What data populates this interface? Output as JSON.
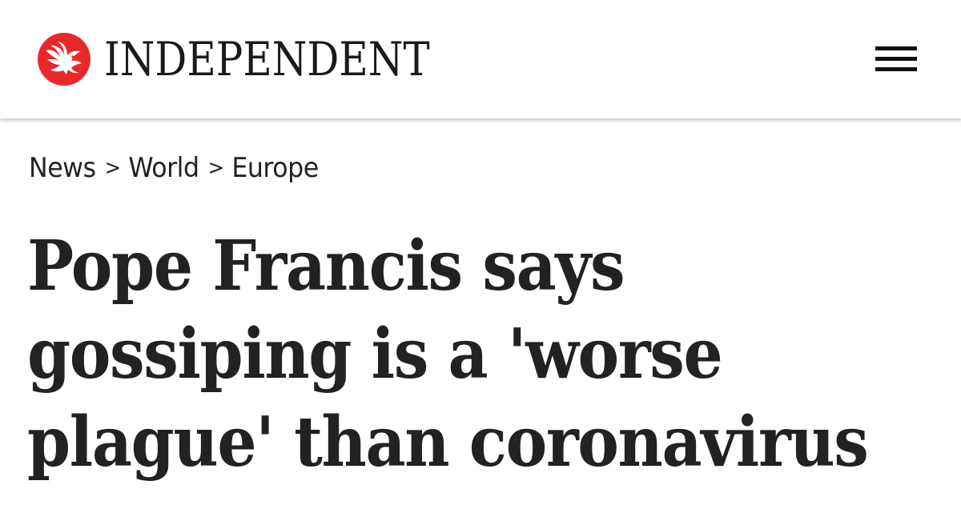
{
  "header": {
    "brand_name": "INDEPENDENT",
    "logo_icon": "eagle-icon",
    "menu_icon": "hamburger-menu-icon",
    "brand_color": "#e8282b"
  },
  "breadcrumb": {
    "items": [
      "News",
      "World",
      "Europe"
    ],
    "separator": ">"
  },
  "article": {
    "headline_lines": [
      "Pope Francis says",
      "gossiping is a 'worse",
      "plague' than coronavirus"
    ]
  }
}
